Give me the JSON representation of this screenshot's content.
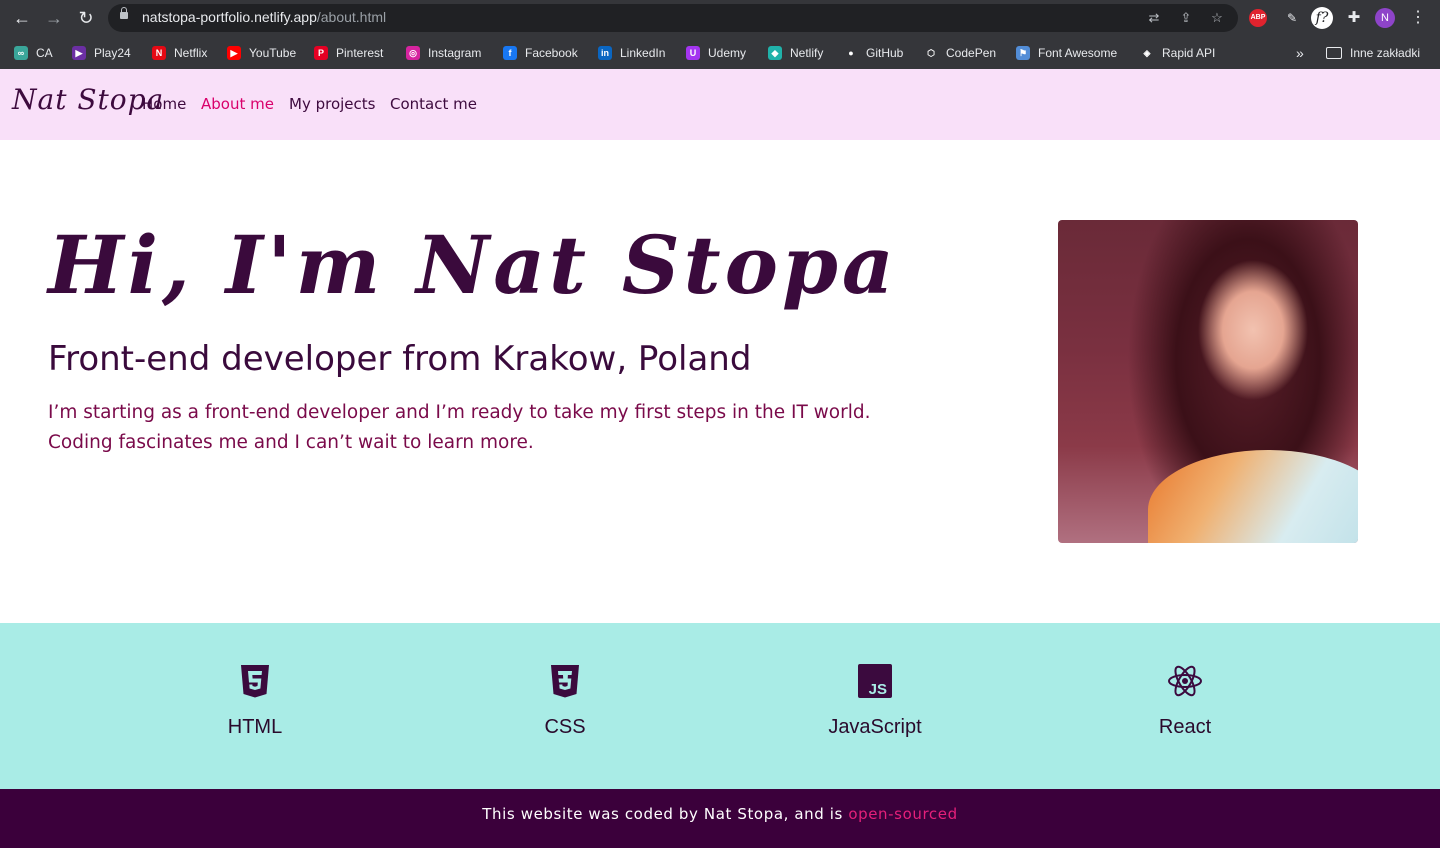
{
  "browser": {
    "url_host": "natstopa-portfolio.netlify.app",
    "url_path": "/about.html",
    "profile_initial": "N",
    "bookmarks": [
      {
        "label": "CA",
        "icon": "ca-icon",
        "color": "#3aa69a"
      },
      {
        "label": "Play24",
        "icon": "play-icon",
        "color": "#6b2fa3"
      },
      {
        "label": "Netflix",
        "icon": "netflix-icon",
        "color": "#e50914"
      },
      {
        "label": "YouTube",
        "icon": "youtube-icon",
        "color": "#ff0000"
      },
      {
        "label": "Pinterest",
        "icon": "pinterest-icon",
        "color": "#e60023"
      },
      {
        "label": "Instagram",
        "icon": "instagram-icon",
        "color": "#d6249f"
      },
      {
        "label": "Facebook",
        "icon": "facebook-icon",
        "color": "#1877f2"
      },
      {
        "label": "LinkedIn",
        "icon": "linkedin-icon",
        "color": "#0a66c2"
      },
      {
        "label": "Udemy",
        "icon": "udemy-icon",
        "color": "#a435f0"
      },
      {
        "label": "Netlify",
        "icon": "netlify-icon",
        "color": "#20b2aa"
      },
      {
        "label": "GitHub",
        "icon": "github-icon",
        "color": "#ffffff"
      },
      {
        "label": "CodePen",
        "icon": "codepen-icon",
        "color": "#ffffff"
      },
      {
        "label": "Font Awesome",
        "icon": "font-awesome-icon",
        "color": "#528dd7"
      },
      {
        "label": "Rapid API",
        "icon": "rapid-api-icon",
        "color": "#ffffff"
      }
    ],
    "more_bookmarks": "»",
    "other_bookmarks": "Inne zakładki"
  },
  "site": {
    "brand": "Nat Stopa",
    "nav": [
      {
        "label": "Home",
        "active": false
      },
      {
        "label": "About me",
        "active": true
      },
      {
        "label": "My projects",
        "active": false
      },
      {
        "label": "Contact me",
        "active": false
      }
    ],
    "hero": {
      "title": "Hi, I'm Nat Stopa",
      "subtitle": "Front-end developer from Krakow, Poland",
      "text": "I’m starting as a front-end developer and I’m ready to take my first steps in the IT world. Coding fascinates me and I can’t wait to learn more."
    },
    "skills": [
      {
        "label": "HTML",
        "icon": "html5-icon"
      },
      {
        "label": "CSS",
        "icon": "css3-icon"
      },
      {
        "label": "JavaScript",
        "icon": "js-icon"
      },
      {
        "label": "React",
        "icon": "react-icon"
      }
    ],
    "footer": {
      "text": "This website was coded by Nat Stopa, and is ",
      "link": "open-sourced"
    }
  },
  "colors": {
    "navbar_bg": "#f9e0f9",
    "accent": "#d9006b",
    "dark_purple": "#3b003b",
    "skills_bg": "#a9ece6"
  }
}
